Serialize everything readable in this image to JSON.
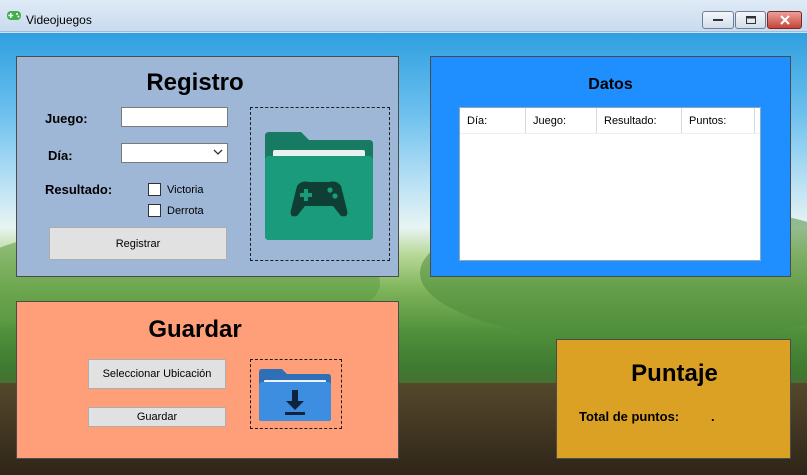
{
  "window": {
    "title": "Videojuegos"
  },
  "registro": {
    "title": "Registro",
    "juego_label": "Juego:",
    "juego_value": "",
    "dia_label": "Día:",
    "dia_value": "",
    "resultado_label": "Resultado:",
    "options": [
      {
        "label": "Victoria",
        "checked": false
      },
      {
        "label": "Derrota",
        "checked": false
      }
    ],
    "register_button": "Registrar"
  },
  "datos": {
    "title": "Datos",
    "columns": [
      "Día:",
      "Juego:",
      "Resultado:",
      "Puntos:"
    ]
  },
  "guardar": {
    "title": "Guardar",
    "select_location_button": "Seleccionar Ubicación",
    "save_button": "Guardar"
  },
  "puntaje": {
    "title": "Puntaje",
    "total_label": "Total de puntos:",
    "total_value": "."
  },
  "colors": {
    "registro_bg": "#9fb7d6",
    "datos_bg": "#1f8fff",
    "guardar_bg": "#ff9f7a",
    "puntaje_bg": "#dba125",
    "folder_green": "#1a9c7c",
    "folder_blue": "#3d8de0"
  },
  "icons": [
    "gamepad-app-icon",
    "minimize-icon",
    "maximize-icon",
    "close-icon",
    "game-folder-icon",
    "download-folder-icon"
  ]
}
